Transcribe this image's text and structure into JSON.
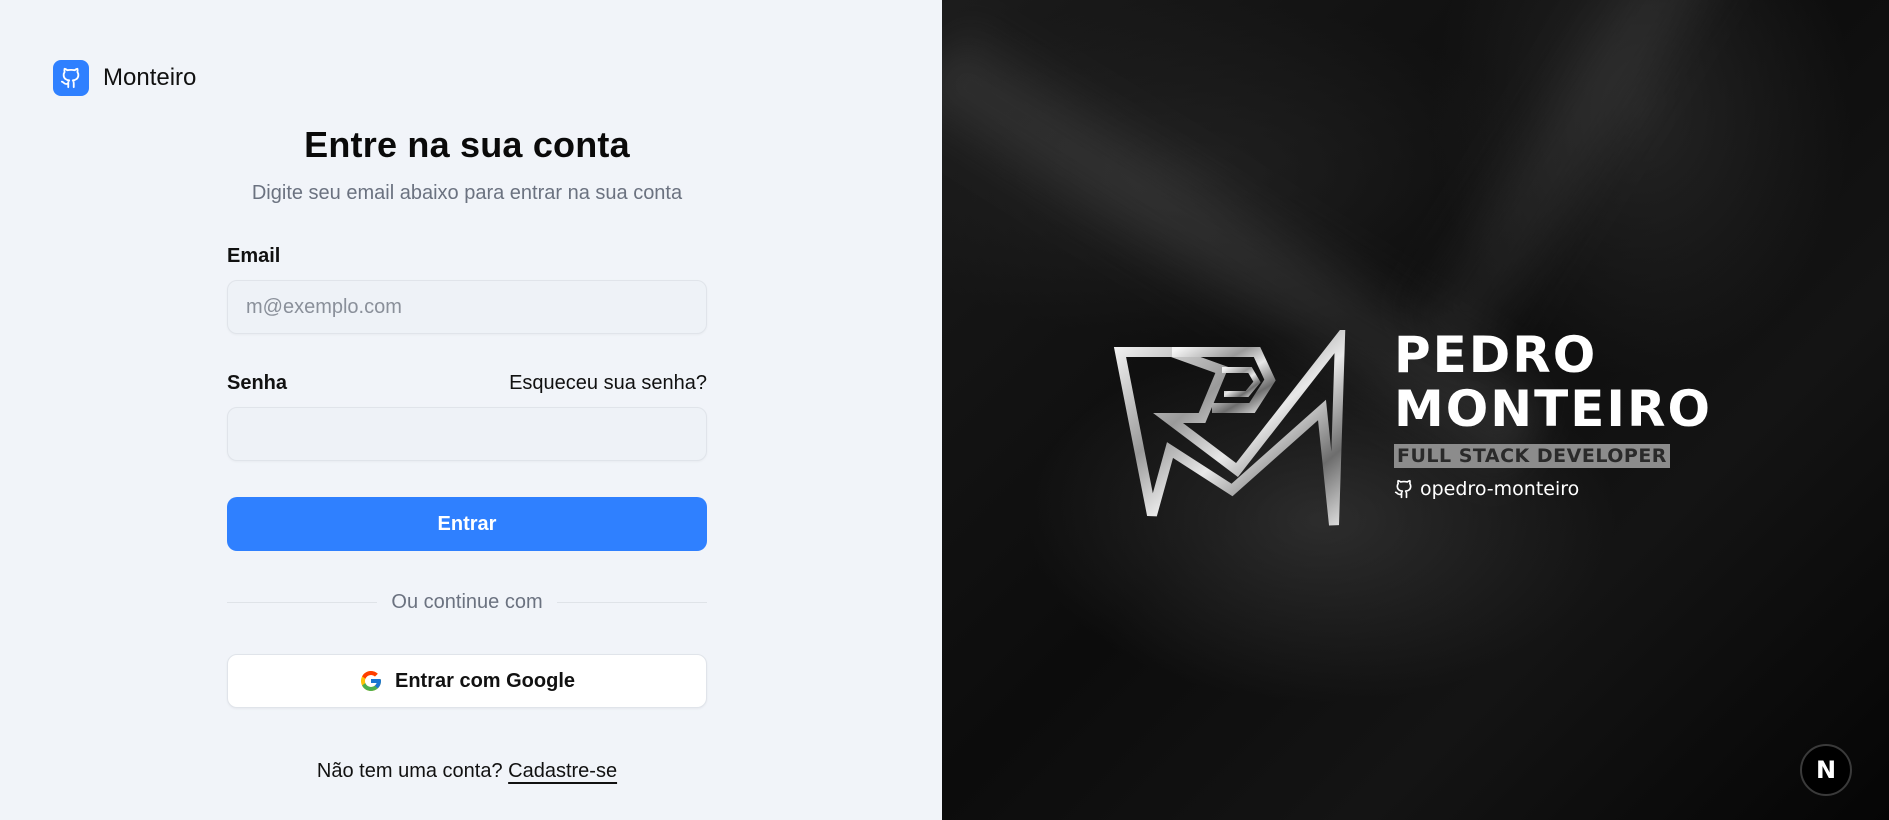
{
  "brand": {
    "name": "Monteiro",
    "logo_icon": "github-icon",
    "color": "#2f80ff"
  },
  "login": {
    "title": "Entre na sua conta",
    "subtitle": "Digite seu email abaixo para entrar na sua conta",
    "email_label": "Email",
    "email_placeholder": "m@exemplo.com",
    "email_value": "",
    "password_label": "Senha",
    "password_value": "",
    "forgot_link": "Esqueceu sua senha?",
    "submit_label": "Entrar",
    "divider_text": "Ou continue com",
    "google_label": "Entrar com Google",
    "google_icon": "google-icon",
    "signup_prompt": "Não tem uma conta?",
    "signup_link": "Cadastre-se"
  },
  "hero": {
    "name_line1": "PEDRO",
    "name_line2": "MONTEIRO",
    "role": "FULL STACK DEVELOPER",
    "github_handle": "opedro-monteiro",
    "github_icon": "github-icon",
    "logo": "pm-monogram-logo"
  },
  "corner_badge": {
    "letter": "N"
  }
}
